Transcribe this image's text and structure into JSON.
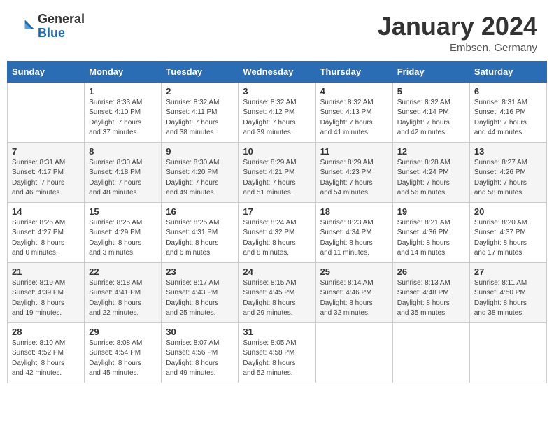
{
  "header": {
    "logo_general": "General",
    "logo_blue": "Blue",
    "month_title": "January 2024",
    "location": "Embsen, Germany"
  },
  "days_of_week": [
    "Sunday",
    "Monday",
    "Tuesday",
    "Wednesday",
    "Thursday",
    "Friday",
    "Saturday"
  ],
  "weeks": [
    [
      {
        "day": "",
        "info": ""
      },
      {
        "day": "1",
        "info": "Sunrise: 8:33 AM\nSunset: 4:10 PM\nDaylight: 7 hours\nand 37 minutes."
      },
      {
        "day": "2",
        "info": "Sunrise: 8:32 AM\nSunset: 4:11 PM\nDaylight: 7 hours\nand 38 minutes."
      },
      {
        "day": "3",
        "info": "Sunrise: 8:32 AM\nSunset: 4:12 PM\nDaylight: 7 hours\nand 39 minutes."
      },
      {
        "day": "4",
        "info": "Sunrise: 8:32 AM\nSunset: 4:13 PM\nDaylight: 7 hours\nand 41 minutes."
      },
      {
        "day": "5",
        "info": "Sunrise: 8:32 AM\nSunset: 4:14 PM\nDaylight: 7 hours\nand 42 minutes."
      },
      {
        "day": "6",
        "info": "Sunrise: 8:31 AM\nSunset: 4:16 PM\nDaylight: 7 hours\nand 44 minutes."
      }
    ],
    [
      {
        "day": "7",
        "info": "Sunrise: 8:31 AM\nSunset: 4:17 PM\nDaylight: 7 hours\nand 46 minutes."
      },
      {
        "day": "8",
        "info": "Sunrise: 8:30 AM\nSunset: 4:18 PM\nDaylight: 7 hours\nand 48 minutes."
      },
      {
        "day": "9",
        "info": "Sunrise: 8:30 AM\nSunset: 4:20 PM\nDaylight: 7 hours\nand 49 minutes."
      },
      {
        "day": "10",
        "info": "Sunrise: 8:29 AM\nSunset: 4:21 PM\nDaylight: 7 hours\nand 51 minutes."
      },
      {
        "day": "11",
        "info": "Sunrise: 8:29 AM\nSunset: 4:23 PM\nDaylight: 7 hours\nand 54 minutes."
      },
      {
        "day": "12",
        "info": "Sunrise: 8:28 AM\nSunset: 4:24 PM\nDaylight: 7 hours\nand 56 minutes."
      },
      {
        "day": "13",
        "info": "Sunrise: 8:27 AM\nSunset: 4:26 PM\nDaylight: 7 hours\nand 58 minutes."
      }
    ],
    [
      {
        "day": "14",
        "info": "Sunrise: 8:26 AM\nSunset: 4:27 PM\nDaylight: 8 hours\nand 0 minutes."
      },
      {
        "day": "15",
        "info": "Sunrise: 8:25 AM\nSunset: 4:29 PM\nDaylight: 8 hours\nand 3 minutes."
      },
      {
        "day": "16",
        "info": "Sunrise: 8:25 AM\nSunset: 4:31 PM\nDaylight: 8 hours\nand 6 minutes."
      },
      {
        "day": "17",
        "info": "Sunrise: 8:24 AM\nSunset: 4:32 PM\nDaylight: 8 hours\nand 8 minutes."
      },
      {
        "day": "18",
        "info": "Sunrise: 8:23 AM\nSunset: 4:34 PM\nDaylight: 8 hours\nand 11 minutes."
      },
      {
        "day": "19",
        "info": "Sunrise: 8:21 AM\nSunset: 4:36 PM\nDaylight: 8 hours\nand 14 minutes."
      },
      {
        "day": "20",
        "info": "Sunrise: 8:20 AM\nSunset: 4:37 PM\nDaylight: 8 hours\nand 17 minutes."
      }
    ],
    [
      {
        "day": "21",
        "info": "Sunrise: 8:19 AM\nSunset: 4:39 PM\nDaylight: 8 hours\nand 19 minutes."
      },
      {
        "day": "22",
        "info": "Sunrise: 8:18 AM\nSunset: 4:41 PM\nDaylight: 8 hours\nand 22 minutes."
      },
      {
        "day": "23",
        "info": "Sunrise: 8:17 AM\nSunset: 4:43 PM\nDaylight: 8 hours\nand 25 minutes."
      },
      {
        "day": "24",
        "info": "Sunrise: 8:15 AM\nSunset: 4:45 PM\nDaylight: 8 hours\nand 29 minutes."
      },
      {
        "day": "25",
        "info": "Sunrise: 8:14 AM\nSunset: 4:46 PM\nDaylight: 8 hours\nand 32 minutes."
      },
      {
        "day": "26",
        "info": "Sunrise: 8:13 AM\nSunset: 4:48 PM\nDaylight: 8 hours\nand 35 minutes."
      },
      {
        "day": "27",
        "info": "Sunrise: 8:11 AM\nSunset: 4:50 PM\nDaylight: 8 hours\nand 38 minutes."
      }
    ],
    [
      {
        "day": "28",
        "info": "Sunrise: 8:10 AM\nSunset: 4:52 PM\nDaylight: 8 hours\nand 42 minutes."
      },
      {
        "day": "29",
        "info": "Sunrise: 8:08 AM\nSunset: 4:54 PM\nDaylight: 8 hours\nand 45 minutes."
      },
      {
        "day": "30",
        "info": "Sunrise: 8:07 AM\nSunset: 4:56 PM\nDaylight: 8 hours\nand 49 minutes."
      },
      {
        "day": "31",
        "info": "Sunrise: 8:05 AM\nSunset: 4:58 PM\nDaylight: 8 hours\nand 52 minutes."
      },
      {
        "day": "",
        "info": ""
      },
      {
        "day": "",
        "info": ""
      },
      {
        "day": "",
        "info": ""
      }
    ]
  ]
}
